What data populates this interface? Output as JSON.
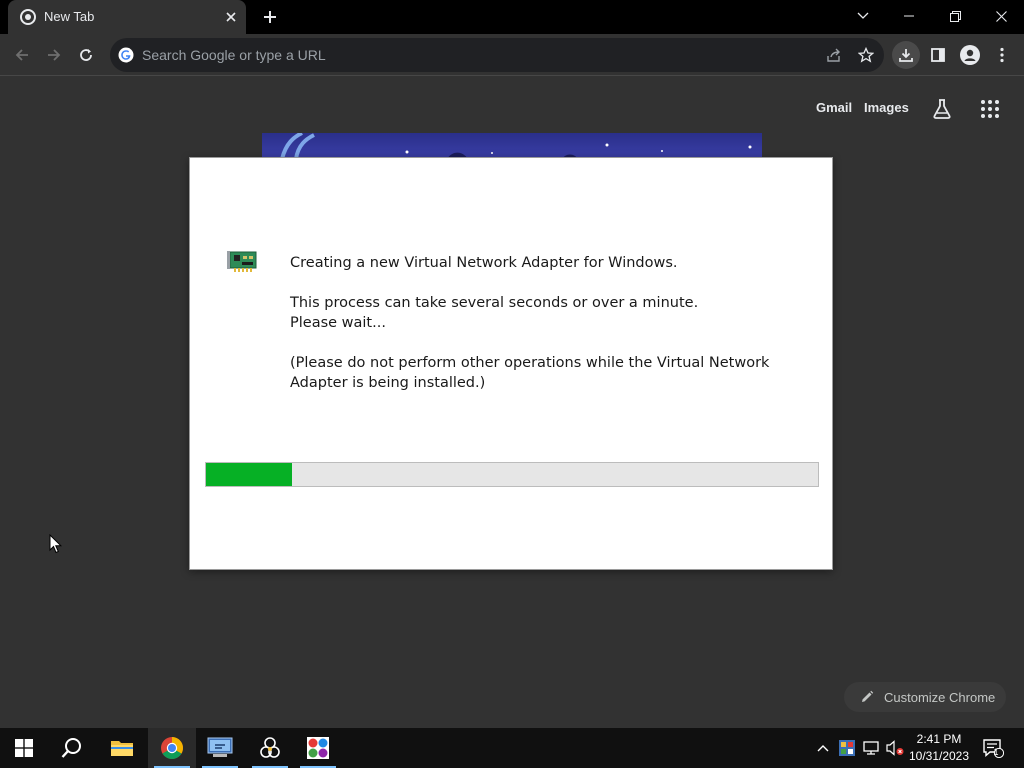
{
  "browser": {
    "tab_title": "New Tab",
    "search_placeholder": "Search Google or type a URL"
  },
  "ntp": {
    "gmail_label": "Gmail",
    "images_label": "Images",
    "customize_label": "Customize Chrome"
  },
  "dialog": {
    "line1": "Creating a new Virtual Network Adapter for Windows.",
    "line2": "This process can take several seconds or over a minute.",
    "line3": "Please wait...",
    "line4": "(Please do not perform other operations while the Virtual Network Adapter is being installed.)",
    "progress": 0.14
  },
  "taskbar": {
    "time": "2:41 PM",
    "date": "10/31/2023",
    "notification_count": "1"
  },
  "icons": {
    "accent_green": "#06b025",
    "taskbar_highlight": "#7fc4ff"
  }
}
